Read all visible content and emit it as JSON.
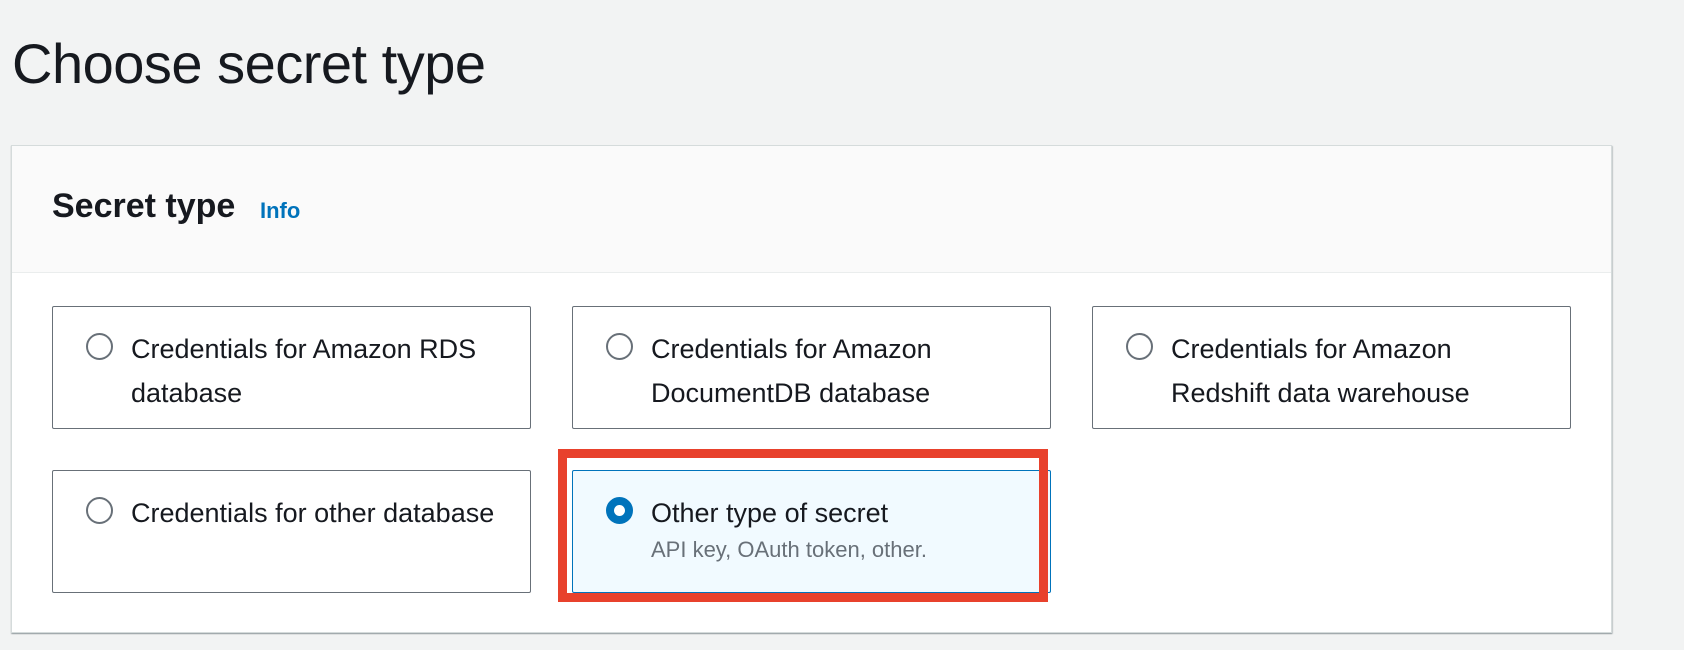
{
  "page": {
    "title": "Choose secret type"
  },
  "panel": {
    "title": "Secret type",
    "info_link": "Info"
  },
  "options": [
    {
      "label": "Credentials for Amazon RDS database",
      "description": "",
      "selected": false
    },
    {
      "label": "Credentials for Amazon DocumentDB database",
      "description": "",
      "selected": false
    },
    {
      "label": "Credentials for Amazon Redshift data warehouse",
      "description": "",
      "selected": false
    },
    {
      "label": "Credentials for other database",
      "description": "",
      "selected": false
    },
    {
      "label": "Other type of secret",
      "description": "API key, OAuth token, other.",
      "selected": true
    }
  ],
  "colors": {
    "accent": "#0073bb",
    "highlight": "#e8412c",
    "background": "#f2f3f3",
    "selected_tile_bg": "#f1faff"
  },
  "icons": {
    "unchecked": "radio-unchecked-icon",
    "checked": "radio-checked-icon"
  }
}
